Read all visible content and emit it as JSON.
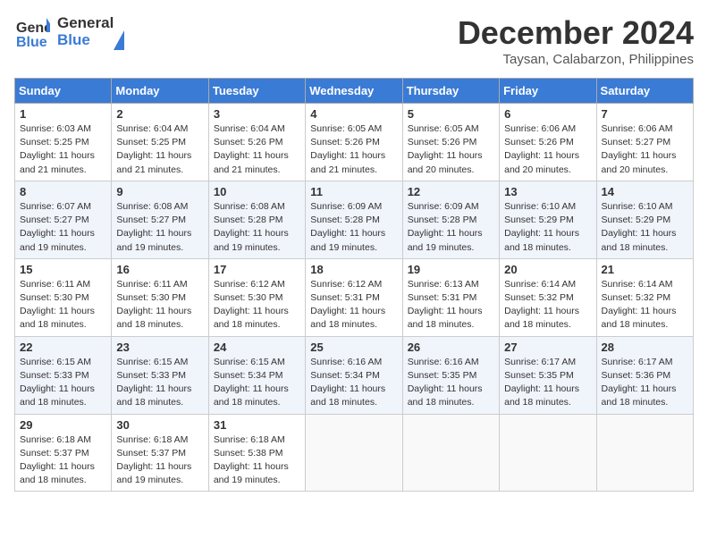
{
  "header": {
    "logo_general": "General",
    "logo_blue": "Blue",
    "title": "December 2024",
    "location": "Taysan, Calabarzon, Philippines"
  },
  "calendar": {
    "days_of_week": [
      "Sunday",
      "Monday",
      "Tuesday",
      "Wednesday",
      "Thursday",
      "Friday",
      "Saturday"
    ],
    "weeks": [
      [
        {
          "day": "1",
          "info": "Sunrise: 6:03 AM\nSunset: 5:25 PM\nDaylight: 11 hours\nand 21 minutes."
        },
        {
          "day": "2",
          "info": "Sunrise: 6:04 AM\nSunset: 5:25 PM\nDaylight: 11 hours\nand 21 minutes."
        },
        {
          "day": "3",
          "info": "Sunrise: 6:04 AM\nSunset: 5:26 PM\nDaylight: 11 hours\nand 21 minutes."
        },
        {
          "day": "4",
          "info": "Sunrise: 6:05 AM\nSunset: 5:26 PM\nDaylight: 11 hours\nand 21 minutes."
        },
        {
          "day": "5",
          "info": "Sunrise: 6:05 AM\nSunset: 5:26 PM\nDaylight: 11 hours\nand 20 minutes."
        },
        {
          "day": "6",
          "info": "Sunrise: 6:06 AM\nSunset: 5:26 PM\nDaylight: 11 hours\nand 20 minutes."
        },
        {
          "day": "7",
          "info": "Sunrise: 6:06 AM\nSunset: 5:27 PM\nDaylight: 11 hours\nand 20 minutes."
        }
      ],
      [
        {
          "day": "8",
          "info": "Sunrise: 6:07 AM\nSunset: 5:27 PM\nDaylight: 11 hours\nand 19 minutes."
        },
        {
          "day": "9",
          "info": "Sunrise: 6:08 AM\nSunset: 5:27 PM\nDaylight: 11 hours\nand 19 minutes."
        },
        {
          "day": "10",
          "info": "Sunrise: 6:08 AM\nSunset: 5:28 PM\nDaylight: 11 hours\nand 19 minutes."
        },
        {
          "day": "11",
          "info": "Sunrise: 6:09 AM\nSunset: 5:28 PM\nDaylight: 11 hours\nand 19 minutes."
        },
        {
          "day": "12",
          "info": "Sunrise: 6:09 AM\nSunset: 5:28 PM\nDaylight: 11 hours\nand 19 minutes."
        },
        {
          "day": "13",
          "info": "Sunrise: 6:10 AM\nSunset: 5:29 PM\nDaylight: 11 hours\nand 18 minutes."
        },
        {
          "day": "14",
          "info": "Sunrise: 6:10 AM\nSunset: 5:29 PM\nDaylight: 11 hours\nand 18 minutes."
        }
      ],
      [
        {
          "day": "15",
          "info": "Sunrise: 6:11 AM\nSunset: 5:30 PM\nDaylight: 11 hours\nand 18 minutes."
        },
        {
          "day": "16",
          "info": "Sunrise: 6:11 AM\nSunset: 5:30 PM\nDaylight: 11 hours\nand 18 minutes."
        },
        {
          "day": "17",
          "info": "Sunrise: 6:12 AM\nSunset: 5:30 PM\nDaylight: 11 hours\nand 18 minutes."
        },
        {
          "day": "18",
          "info": "Sunrise: 6:12 AM\nSunset: 5:31 PM\nDaylight: 11 hours\nand 18 minutes."
        },
        {
          "day": "19",
          "info": "Sunrise: 6:13 AM\nSunset: 5:31 PM\nDaylight: 11 hours\nand 18 minutes."
        },
        {
          "day": "20",
          "info": "Sunrise: 6:14 AM\nSunset: 5:32 PM\nDaylight: 11 hours\nand 18 minutes."
        },
        {
          "day": "21",
          "info": "Sunrise: 6:14 AM\nSunset: 5:32 PM\nDaylight: 11 hours\nand 18 minutes."
        }
      ],
      [
        {
          "day": "22",
          "info": "Sunrise: 6:15 AM\nSunset: 5:33 PM\nDaylight: 11 hours\nand 18 minutes."
        },
        {
          "day": "23",
          "info": "Sunrise: 6:15 AM\nSunset: 5:33 PM\nDaylight: 11 hours\nand 18 minutes."
        },
        {
          "day": "24",
          "info": "Sunrise: 6:15 AM\nSunset: 5:34 PM\nDaylight: 11 hours\nand 18 minutes."
        },
        {
          "day": "25",
          "info": "Sunrise: 6:16 AM\nSunset: 5:34 PM\nDaylight: 11 hours\nand 18 minutes."
        },
        {
          "day": "26",
          "info": "Sunrise: 6:16 AM\nSunset: 5:35 PM\nDaylight: 11 hours\nand 18 minutes."
        },
        {
          "day": "27",
          "info": "Sunrise: 6:17 AM\nSunset: 5:35 PM\nDaylight: 11 hours\nand 18 minutes."
        },
        {
          "day": "28",
          "info": "Sunrise: 6:17 AM\nSunset: 5:36 PM\nDaylight: 11 hours\nand 18 minutes."
        }
      ],
      [
        {
          "day": "29",
          "info": "Sunrise: 6:18 AM\nSunset: 5:37 PM\nDaylight: 11 hours\nand 18 minutes."
        },
        {
          "day": "30",
          "info": "Sunrise: 6:18 AM\nSunset: 5:37 PM\nDaylight: 11 hours\nand 19 minutes."
        },
        {
          "day": "31",
          "info": "Sunrise: 6:18 AM\nSunset: 5:38 PM\nDaylight: 11 hours\nand 19 minutes."
        },
        {
          "day": "",
          "info": ""
        },
        {
          "day": "",
          "info": ""
        },
        {
          "day": "",
          "info": ""
        },
        {
          "day": "",
          "info": ""
        }
      ]
    ]
  }
}
